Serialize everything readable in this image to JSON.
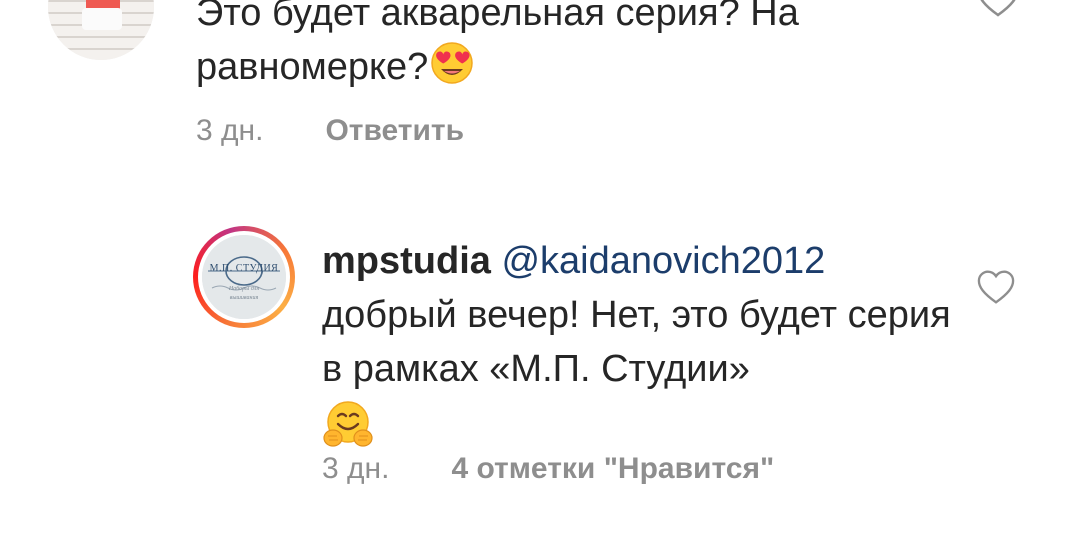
{
  "comment1": {
    "text": "Это будет акварельная серия? На равномерке?",
    "emoji": "heart-eyes-emoji",
    "time": "3 дн.",
    "reply_label": "Ответить"
  },
  "comment2": {
    "username": "mpstudia",
    "mention": "@kaidanovich2012",
    "text": "добрый вечер! Нет, это будет серия в рамках «М.П. Студии»",
    "emoji": "hugging-face-emoji",
    "time": "3 дн.",
    "likes_label": "4 отметки \"Нравится\"",
    "avatar_logo": {
      "title": "М.П. СТУДИЯ",
      "subtitle": "Наборы для вышивания"
    }
  },
  "colors": {
    "text": "#262626",
    "meta": "#8e8e8e",
    "mention": "#1c3d6b"
  }
}
